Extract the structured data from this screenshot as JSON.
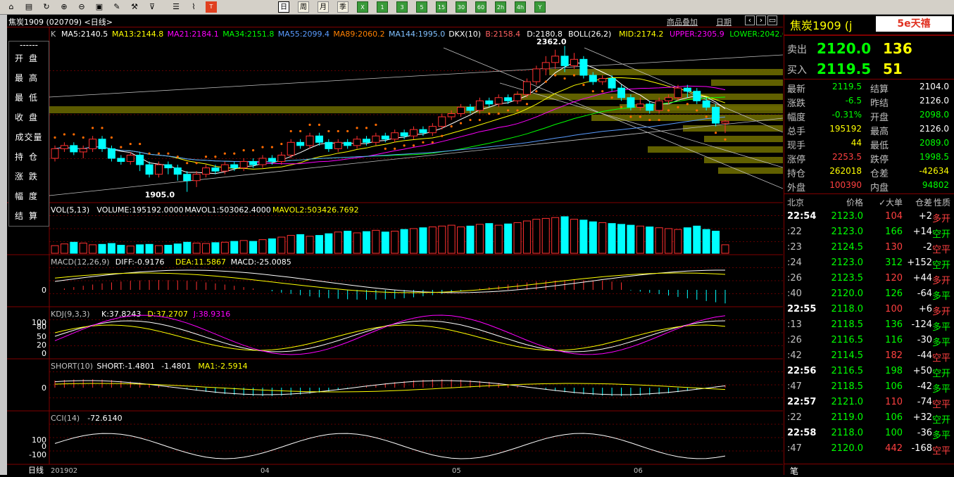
{
  "window_title": "焦炭1909 (020709) <日线>",
  "toolbar": {
    "buttons": [
      "home-icon",
      "file-icon",
      "refresh-icon",
      "zoom-in-icon",
      "zoom-out-icon",
      "window-icon",
      "pen-icon",
      "tools-icon",
      "filter-icon",
      "table-icon",
      "chart-icon",
      "tick-icon"
    ],
    "periods": [
      "日",
      "周",
      "月",
      "季",
      "X",
      "1",
      "3",
      "5",
      "15",
      "30",
      "60",
      "2h",
      "4h",
      "Y"
    ]
  },
  "side_menu": [
    "开盘",
    "最高",
    "最低",
    "收盘",
    "成交量",
    "持仓",
    "涨跌",
    "幅度",
    "结算"
  ],
  "chart_header": {
    "overlay_link": "商品叠加",
    "period_link": "日期"
  },
  "price_panel": {
    "k_label": "K",
    "ma": [
      {
        "text": "MA5:2140.5",
        "color": "#ffffff"
      },
      {
        "text": "MA13:2144.8",
        "color": "#ffff00"
      },
      {
        "text": "MA21:2184.1",
        "color": "#ff00ff"
      },
      {
        "text": "MA34:2151.8",
        "color": "#00ff00"
      },
      {
        "text": "MA55:2099.4",
        "color": "#5a9cff"
      },
      {
        "text": "MA89:2060.2",
        "color": "#ff8000"
      },
      {
        "text": "MA144:1995.0",
        "color": "#80c0ff"
      },
      {
        "text": "DKX(10)",
        "color": "#ffffff"
      },
      {
        "text": "B:2158.4",
        "color": "#ff6060"
      },
      {
        "text": "D:2180.8",
        "color": "#ffffff"
      },
      {
        "text": "BOLL(26,2)",
        "color": "#ffffff"
      },
      {
        "text": "MID:2174.2",
        "color": "#ffff00"
      },
      {
        "text": "UPPER:2305.9",
        "color": "#ff00ff"
      },
      {
        "text": "LOWER:2042.6",
        "color": "#00ff00"
      }
    ],
    "high_mark": "2362.0",
    "low_mark": "1905.0"
  },
  "vol_panel": {
    "items": [
      {
        "text": "VOL(5,13)",
        "color": "#ffffff"
      },
      {
        "text": "VOLUME:195192.0000",
        "color": "#ffffff"
      },
      {
        "text": "MAVOL1:503062.4000",
        "color": "#ffffff"
      },
      {
        "text": "MAVOL2:503426.7692",
        "color": "#ffff00"
      }
    ]
  },
  "macd_panel": {
    "items": [
      {
        "text": "MACD(12,26,9)",
        "color": "#c0c0c0"
      },
      {
        "text": "DIFF:-0.9176",
        "color": "#ffffff"
      },
      {
        "text": "DEA:11.5867",
        "color": "#ffff00"
      },
      {
        "text": "MACD:-25.0085",
        "color": "#ffffff"
      }
    ],
    "axis": [
      "0"
    ]
  },
  "kdj_panel": {
    "items": [
      {
        "text": "KDJ(9,3,3)",
        "color": "#c0c0c0"
      },
      {
        "text": "K:37.8243",
        "color": "#ffffff"
      },
      {
        "text": "D:37.2707",
        "color": "#ffff00"
      },
      {
        "text": "J:38.9316",
        "color": "#ff00ff"
      }
    ],
    "axis": [
      "100",
      "80",
      "50",
      "20",
      "0"
    ]
  },
  "short_panel": {
    "items": [
      {
        "text": "SHORT(10)",
        "color": "#c0c0c0"
      },
      {
        "text": "SHORT:-1.4801",
        "color": "#ffffff"
      },
      {
        "text": "-1.4801",
        "color": "#ffffff"
      },
      {
        "text": "MA1:-2.5914",
        "color": "#ffff00"
      }
    ],
    "axis": [
      "0"
    ]
  },
  "cci_panel": {
    "items": [
      {
        "text": "CCI(14)",
        "color": "#c0c0c0"
      },
      {
        "text": "-72.6140",
        "color": "#ffffff"
      }
    ],
    "axis": [
      "100",
      "0",
      "-100"
    ]
  },
  "x_axis": {
    "left_label": "日线",
    "labels": [
      "201902",
      "04",
      "05",
      "06"
    ]
  },
  "info": {
    "title": "焦炭1909 (j",
    "logo": "5e天禧",
    "sell": {
      "label": "卖出",
      "price": "2120.0",
      "qty": "136"
    },
    "buy": {
      "label": "买入",
      "price": "2119.5",
      "qty": "51"
    },
    "rows": [
      {
        "l1": "最新",
        "v1": "2119.5",
        "c1": "#00ff00",
        "l2": "结算",
        "v2": "2104.0",
        "c2": "#ffffff"
      },
      {
        "l1": "涨跌",
        "v1": "-6.5",
        "c1": "#00ff00",
        "l2": "昨结",
        "v2": "2126.0",
        "c2": "#ffffff"
      },
      {
        "l1": "幅度",
        "v1": "-0.31%",
        "c1": "#00ff00",
        "l2": "开盘",
        "v2": "2098.0",
        "c2": "#00ff00"
      },
      {
        "l1": "总手",
        "v1": "195192",
        "c1": "#ffff00",
        "l2": "最高",
        "v2": "2126.0",
        "c2": "#ffffff"
      },
      {
        "l1": "现手",
        "v1": "44",
        "c1": "#ffff00",
        "l2": "最低",
        "v2": "2089.0",
        "c2": "#00ff00"
      },
      {
        "l1": "涨停",
        "v1": "2253.5",
        "c1": "#ff4040",
        "l2": "跌停",
        "v2": "1998.5",
        "c2": "#00ff00"
      },
      {
        "l1": "持仓",
        "v1": "262018",
        "c1": "#ffff00",
        "l2": "仓差",
        "v2": "-42634",
        "c2": "#ffff00"
      },
      {
        "l1": "外盘",
        "v1": "100390",
        "c1": "#ff4040",
        "l2": "内盘",
        "v2": "94802",
        "c2": "#00ff00"
      }
    ],
    "ticks_header": [
      "北京",
      "价格",
      "✓大单",
      "仓差",
      "性质"
    ],
    "ticks": [
      {
        "time": "22:54",
        "price": "2123.0",
        "pc": "#00ff00",
        "vol": "104",
        "vc": "#ff4040",
        "diff": "+2",
        "dc": "#ffffff",
        "nature": "多开",
        "nc": "#ff4040"
      },
      {
        "time": ":22",
        "price": "2123.0",
        "pc": "#00ff00",
        "vol": "166",
        "vc": "#00ff00",
        "diff": "+14",
        "dc": "#ffffff",
        "nature": "空开",
        "nc": "#00ff00"
      },
      {
        "time": ":23",
        "price": "2124.5",
        "pc": "#00ff00",
        "vol": "130",
        "vc": "#ff4040",
        "diff": "-2",
        "dc": "#ffffff",
        "nature": "空平",
        "nc": "#ff4040"
      },
      {
        "time": ":24",
        "price": "2123.0",
        "pc": "#00ff00",
        "vol": "312",
        "vc": "#00ff00",
        "diff": "+152",
        "dc": "#ffffff",
        "nature": "空开",
        "nc": "#00ff00"
      },
      {
        "time": ":26",
        "price": "2123.5",
        "pc": "#00ff00",
        "vol": "120",
        "vc": "#ff4040",
        "diff": "+44",
        "dc": "#ffffff",
        "nature": "多开",
        "nc": "#ff4040"
      },
      {
        "time": ":40",
        "price": "2120.0",
        "pc": "#00ff00",
        "vol": "126",
        "vc": "#00ff00",
        "diff": "-64",
        "dc": "#ffffff",
        "nature": "多平",
        "nc": "#00ff00"
      },
      {
        "time": "22:55",
        "price": "2118.0",
        "pc": "#00ff00",
        "vol": "100",
        "vc": "#ff4040",
        "diff": "+6",
        "dc": "#ffffff",
        "nature": "多开",
        "nc": "#ff4040"
      },
      {
        "time": ":13",
        "price": "2118.5",
        "pc": "#00ff00",
        "vol": "136",
        "vc": "#00ff00",
        "diff": "-124",
        "dc": "#ffffff",
        "nature": "多平",
        "nc": "#00ff00"
      },
      {
        "time": ":26",
        "price": "2116.5",
        "pc": "#00ff00",
        "vol": "116",
        "vc": "#00ff00",
        "diff": "-30",
        "dc": "#ffffff",
        "nature": "多平",
        "nc": "#00ff00"
      },
      {
        "time": ":42",
        "price": "2114.5",
        "pc": "#00ff00",
        "vol": "182",
        "vc": "#ff4040",
        "diff": "-44",
        "dc": "#ffffff",
        "nature": "空平",
        "nc": "#ff4040"
      },
      {
        "time": "22:56",
        "price": "2116.5",
        "pc": "#00ff00",
        "vol": "198",
        "vc": "#00ff00",
        "diff": "+50",
        "dc": "#ffffff",
        "nature": "空开",
        "nc": "#00ff00"
      },
      {
        "time": ":47",
        "price": "2118.5",
        "pc": "#00ff00",
        "vol": "106",
        "vc": "#00ff00",
        "diff": "-42",
        "dc": "#ffffff",
        "nature": "多平",
        "nc": "#00ff00"
      },
      {
        "time": "22:57",
        "price": "2121.0",
        "pc": "#00ff00",
        "vol": "110",
        "vc": "#ff4040",
        "diff": "-74",
        "dc": "#ffffff",
        "nature": "空平",
        "nc": "#ff4040"
      },
      {
        "time": ":22",
        "price": "2119.0",
        "pc": "#00ff00",
        "vol": "106",
        "vc": "#00ff00",
        "diff": "+32",
        "dc": "#ffffff",
        "nature": "空开",
        "nc": "#00ff00"
      },
      {
        "time": "22:58",
        "price": "2118.0",
        "pc": "#00ff00",
        "vol": "100",
        "vc": "#00ff00",
        "diff": "-36",
        "dc": "#ffffff",
        "nature": "多平",
        "nc": "#00ff00"
      },
      {
        "time": ":47",
        "price": "2120.0",
        "pc": "#00ff00",
        "vol": "442",
        "vc": "#ff4040",
        "diff": "-168",
        "dc": "#ffffff",
        "nature": "空平",
        "nc": "#ff4040"
      }
    ],
    "footer": "笔"
  },
  "chart_data": {
    "type": "candlestick",
    "candles": [
      [
        2010,
        2040,
        2000,
        2050
      ],
      [
        2040,
        2050,
        2030,
        2060
      ],
      [
        2050,
        2030,
        2020,
        2060
      ],
      [
        2030,
        2040,
        2010,
        2050
      ],
      [
        2040,
        2070,
        2030,
        2080
      ],
      [
        2070,
        2040,
        2030,
        2080
      ],
      [
        2040,
        2010,
        2000,
        2050
      ],
      [
        2010,
        2000,
        1990,
        2020
      ],
      [
        2000,
        2020,
        1990,
        2030
      ],
      [
        2020,
        1990,
        1970,
        2030
      ],
      [
        1990,
        1960,
        1950,
        2000
      ],
      [
        1960,
        1990,
        1950,
        2000
      ],
      [
        1990,
        1980,
        1960,
        2000
      ],
      [
        1980,
        1960,
        1940,
        1990
      ],
      [
        1960,
        1940,
        1905,
        1970
      ],
      [
        1940,
        1960,
        1920,
        1970
      ],
      [
        1960,
        1980,
        1950,
        1990
      ],
      [
        1980,
        1970,
        1960,
        1990
      ],
      [
        1970,
        1990,
        1960,
        2000
      ],
      [
        1990,
        1980,
        1970,
        2000
      ],
      [
        1980,
        2000,
        1970,
        2010
      ],
      [
        2000,
        1990,
        1980,
        2010
      ],
      [
        1990,
        2010,
        1980,
        2020
      ],
      [
        2010,
        2000,
        1990,
        2020
      ],
      [
        2000,
        2020,
        1990,
        2030
      ],
      [
        2020,
        2060,
        2010,
        2070
      ],
      [
        2060,
        2050,
        2040,
        2070
      ],
      [
        2050,
        2080,
        2040,
        2090
      ],
      [
        2080,
        2060,
        2050,
        2090
      ],
      [
        2060,
        2040,
        2030,
        2070
      ],
      [
        2040,
        2060,
        2030,
        2070
      ],
      [
        2060,
        2050,
        2040,
        2070
      ],
      [
        2050,
        2070,
        2040,
        2080
      ],
      [
        2070,
        2060,
        2050,
        2080
      ],
      [
        2060,
        2080,
        2050,
        2090
      ],
      [
        2080,
        2070,
        2060,
        2090
      ],
      [
        2070,
        2090,
        2060,
        2100
      ],
      [
        2090,
        2080,
        2070,
        2100
      ],
      [
        2080,
        2100,
        2070,
        2110
      ],
      [
        2100,
        2090,
        2080,
        2110
      ],
      [
        2090,
        2110,
        2080,
        2120
      ],
      [
        2110,
        2140,
        2100,
        2150
      ],
      [
        2140,
        2150,
        2130,
        2160
      ],
      [
        2150,
        2170,
        2140,
        2180
      ],
      [
        2170,
        2160,
        2150,
        2180
      ],
      [
        2160,
        2190,
        2150,
        2200
      ],
      [
        2190,
        2180,
        2170,
        2200
      ],
      [
        2180,
        2200,
        2170,
        2210
      ],
      [
        2200,
        2190,
        2180,
        2210
      ],
      [
        2190,
        2210,
        2180,
        2220
      ],
      [
        2210,
        2250,
        2200,
        2260
      ],
      [
        2250,
        2290,
        2240,
        2300
      ],
      [
        2290,
        2310,
        2270,
        2330
      ],
      [
        2310,
        2330,
        2290,
        2350
      ],
      [
        2330,
        2300,
        2280,
        2362
      ],
      [
        2300,
        2320,
        2290,
        2340
      ],
      [
        2320,
        2270,
        2260,
        2330
      ],
      [
        2270,
        2250,
        2240,
        2280
      ],
      [
        2250,
        2260,
        2240,
        2270
      ],
      [
        2260,
        2230,
        2220,
        2270
      ],
      [
        2230,
        2200,
        2190,
        2240
      ],
      [
        2200,
        2170,
        2160,
        2210
      ],
      [
        2170,
        2180,
        2160,
        2200
      ],
      [
        2180,
        2160,
        2150,
        2190
      ],
      [
        2160,
        2190,
        2150,
        2200
      ],
      [
        2190,
        2200,
        2180,
        2210
      ],
      [
        2200,
        2230,
        2190,
        2240
      ],
      [
        2230,
        2220,
        2200,
        2240
      ],
      [
        2220,
        2190,
        2180,
        2230
      ],
      [
        2190,
        2170,
        2160,
        2200
      ],
      [
        2170,
        2120,
        2110,
        2180
      ],
      [
        2120,
        2126,
        2089,
        2130
      ]
    ],
    "volume": [
      180,
      220,
      260,
      240,
      200,
      210,
      230,
      190,
      170,
      200,
      210,
      180,
      190,
      220,
      260,
      240,
      230,
      250,
      260,
      280,
      300,
      280,
      320,
      340,
      380,
      420,
      440,
      400,
      420,
      460,
      500,
      520,
      480,
      510,
      540,
      500,
      520,
      560,
      580,
      600,
      620,
      640,
      660,
      620,
      640,
      680,
      700,
      660,
      690,
      720,
      760,
      800,
      820,
      840,
      860,
      800,
      780,
      740,
      720,
      700,
      680,
      660,
      640,
      620,
      600,
      580,
      560,
      600,
      640,
      560,
      520,
      200
    ],
    "ylim": [
      1880,
      2400
    ],
    "high": 2362.0,
    "low": 1905.0
  }
}
